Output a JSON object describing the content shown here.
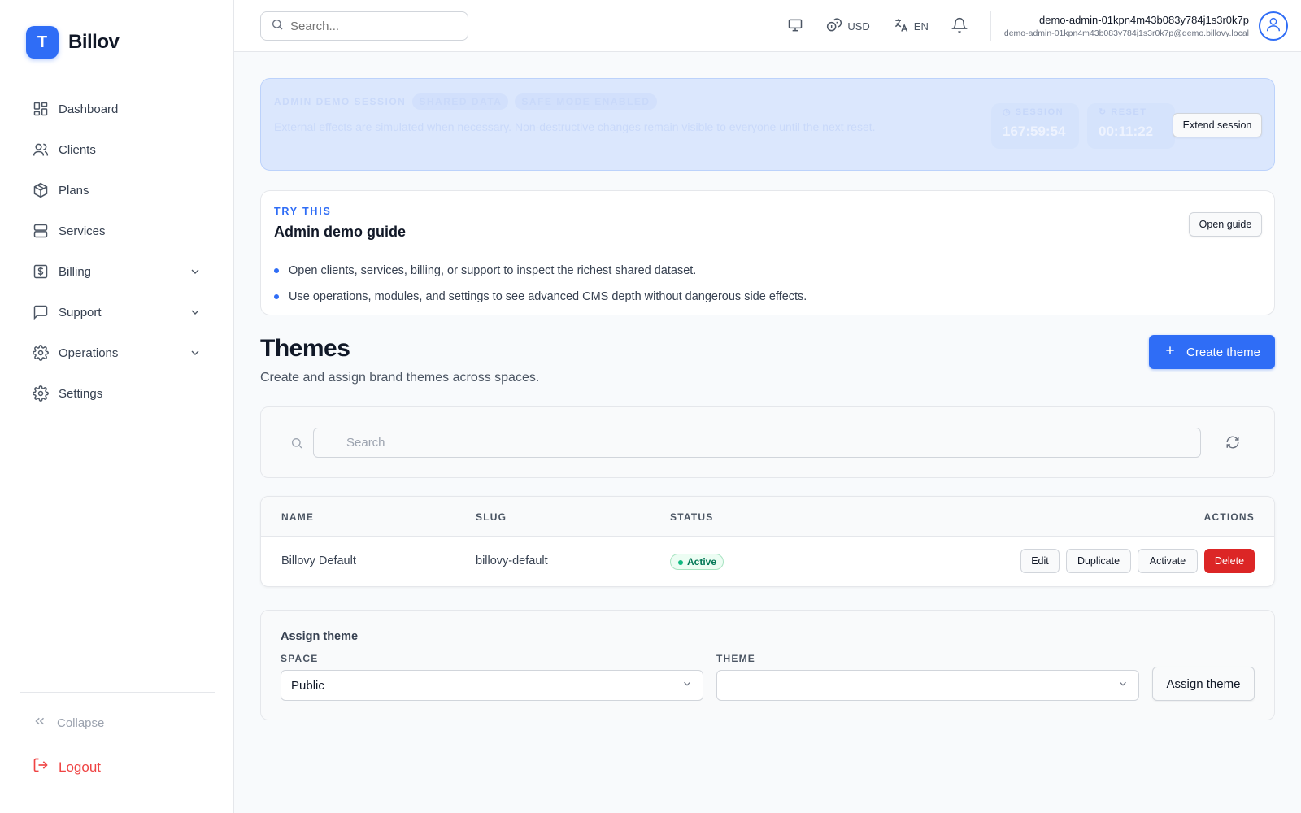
{
  "brand": {
    "logo_letter": "T",
    "name": "Billov",
    "accent": "#2f6df6"
  },
  "sidebar": {
    "items": [
      {
        "label": "Dashboard",
        "icon": "dashboard-icon"
      },
      {
        "label": "Clients",
        "icon": "users-icon"
      },
      {
        "label": "Plans",
        "icon": "package-icon"
      },
      {
        "label": "Services",
        "icon": "server-icon"
      },
      {
        "label": "Billing",
        "icon": "dollar-icon",
        "expandable": true
      },
      {
        "label": "Support",
        "icon": "message-icon",
        "expandable": true
      },
      {
        "label": "Operations",
        "icon": "gear-icon",
        "expandable": true
      },
      {
        "label": "Settings",
        "icon": "gear-icon"
      }
    ],
    "collapse_label": "Collapse",
    "logout_label": "Logout"
  },
  "topbar": {
    "search_placeholder": "Search...",
    "currency": "USD",
    "language": "EN",
    "user_name": "demo-admin-01kpn4m43b083y784j1s3r0k7p",
    "user_email": "demo-admin-01kpn4m43b083y784j1s3r0k7p@demo.billovy.local"
  },
  "demo_banner": {
    "tags": [
      "ADMIN DEMO SESSION",
      "SHARED DATA",
      "SAFE MODE ENABLED"
    ],
    "text": "External effects are simulated when necessary. Non-destructive changes remain visible to everyone until the next reset.",
    "session_label": "SESSION",
    "session_value": "167:59:54",
    "reset_label": "RESET",
    "reset_value": "00:11:22",
    "extend_label": "Extend session"
  },
  "guide": {
    "eyebrow": "TRY THIS",
    "title": "Admin demo guide",
    "open_label": "Open guide",
    "items": [
      "Open clients, services, billing, or support to inspect the richest shared dataset.",
      "Use operations, modules, and settings to see advanced CMS depth without dangerous side effects."
    ]
  },
  "page": {
    "title": "Themes",
    "subtitle": "Create and assign brand themes across spaces.",
    "create_label": "Create theme"
  },
  "filter": {
    "search_placeholder": "Search"
  },
  "table": {
    "headers": [
      "NAME",
      "SLUG",
      "STATUS",
      "ACTIONS"
    ],
    "rows": [
      {
        "name": "Billovy Default",
        "slug": "billovy-default",
        "status": "Active"
      }
    ],
    "actions": {
      "edit": "Edit",
      "duplicate": "Duplicate",
      "activate": "Activate",
      "delete": "Delete"
    }
  },
  "assign": {
    "title": "Assign theme",
    "space_label": "SPACE",
    "space_value": "Public",
    "theme_label": "THEME",
    "theme_value": "",
    "button_label": "Assign theme"
  }
}
